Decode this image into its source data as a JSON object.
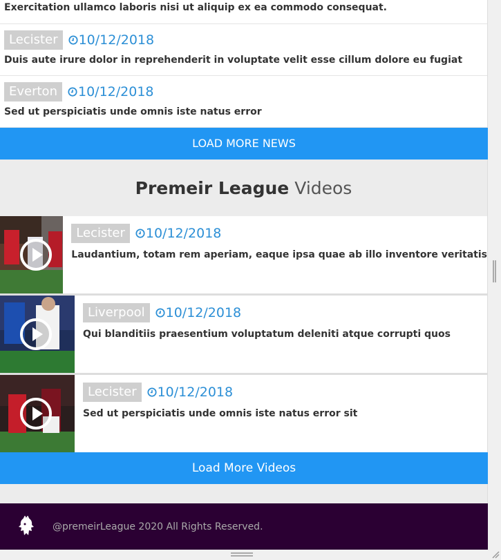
{
  "news": [
    {
      "text": "Exercitation ullamco laboris nisi ut aliquip ex ea commodo consequat."
    },
    {
      "tag": "Lecister",
      "date": "10/12/2018",
      "text": "Duis aute irure dolor in reprehenderit in voluptate velit esse cillum dolore eu fugiat"
    },
    {
      "tag": "Everton",
      "date": "10/12/2018",
      "text": "Sed ut perspiciatis unde omnis iste natus error"
    }
  ],
  "load_more_news": "LOAD MORE NEWS",
  "videos_section": {
    "title_bold": "Premeir League",
    "title_light": "Videos"
  },
  "videos": [
    {
      "tag": "Lecister",
      "date": "10/12/2018",
      "text": "Laudantium, totam rem aperiam, eaque ipsa quae ab illo inventore veritatis"
    },
    {
      "tag": "Liverpool",
      "date": "10/12/2018",
      "text": "Qui blanditiis praesentium voluptatum deleniti atque corrupti quos"
    },
    {
      "tag": "Lecister",
      "date": "10/12/2018",
      "text": "Sed ut perspiciatis unde omnis iste natus error sit"
    }
  ],
  "load_more_videos": "Load More Videos",
  "footer": {
    "copyright": "@premeirLeague 2020 All Rights Reserved."
  },
  "colors": {
    "accent": "#2196f3",
    "date": "#2c8fd6",
    "footer_bg": "#2b0033",
    "tag_bg": "#cfcfcf"
  }
}
